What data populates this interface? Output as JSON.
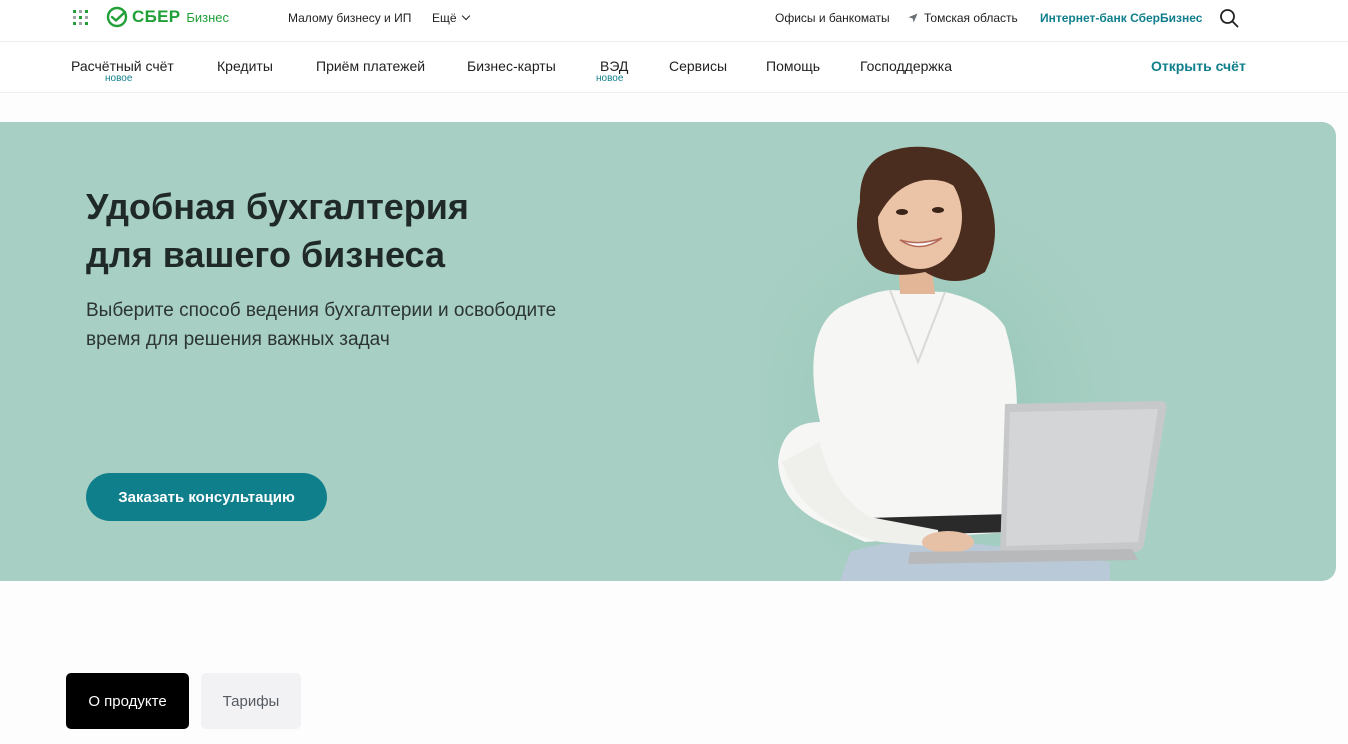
{
  "topbar": {
    "logo_text": "СБЕР",
    "logo_sub": "Бизнес",
    "segment": "Малому бизнесу и ИП",
    "more": "Ещё",
    "offices": "Офисы и банкоматы",
    "region": "Томская область",
    "internet_bank": "Интернет-банк СберБизнес"
  },
  "nav": {
    "items": [
      {
        "label": "Расчётный счёт",
        "badge": "новое"
      },
      {
        "label": "Кредиты"
      },
      {
        "label": "Приём платежей"
      },
      {
        "label": "Бизнес-карты"
      },
      {
        "label": "ВЭД",
        "badge": "новое"
      },
      {
        "label": "Сервисы"
      },
      {
        "label": "Помощь"
      },
      {
        "label": "Господдержка"
      }
    ],
    "open_account": "Открыть счёт"
  },
  "hero": {
    "title_lines": [
      "Удобная бухгалтерия",
      "для вашего бизнеса"
    ],
    "subtitle_lines": [
      "Выберите способ ведения бухгалтерии и освободите",
      "время для решения важных задач"
    ],
    "button": "Заказать консультацию"
  },
  "tabs": {
    "active": "О продукте",
    "inactive": "Тарифы"
  },
  "colors": {
    "brand_green": "#21a038",
    "accent_teal": "#107f8c",
    "hero_bg": "#a8cfc3"
  },
  "icons": [
    "apps-grid-icon",
    "sber-logo-icon",
    "chevron-down-icon",
    "location-arrow-icon",
    "search-icon"
  ]
}
